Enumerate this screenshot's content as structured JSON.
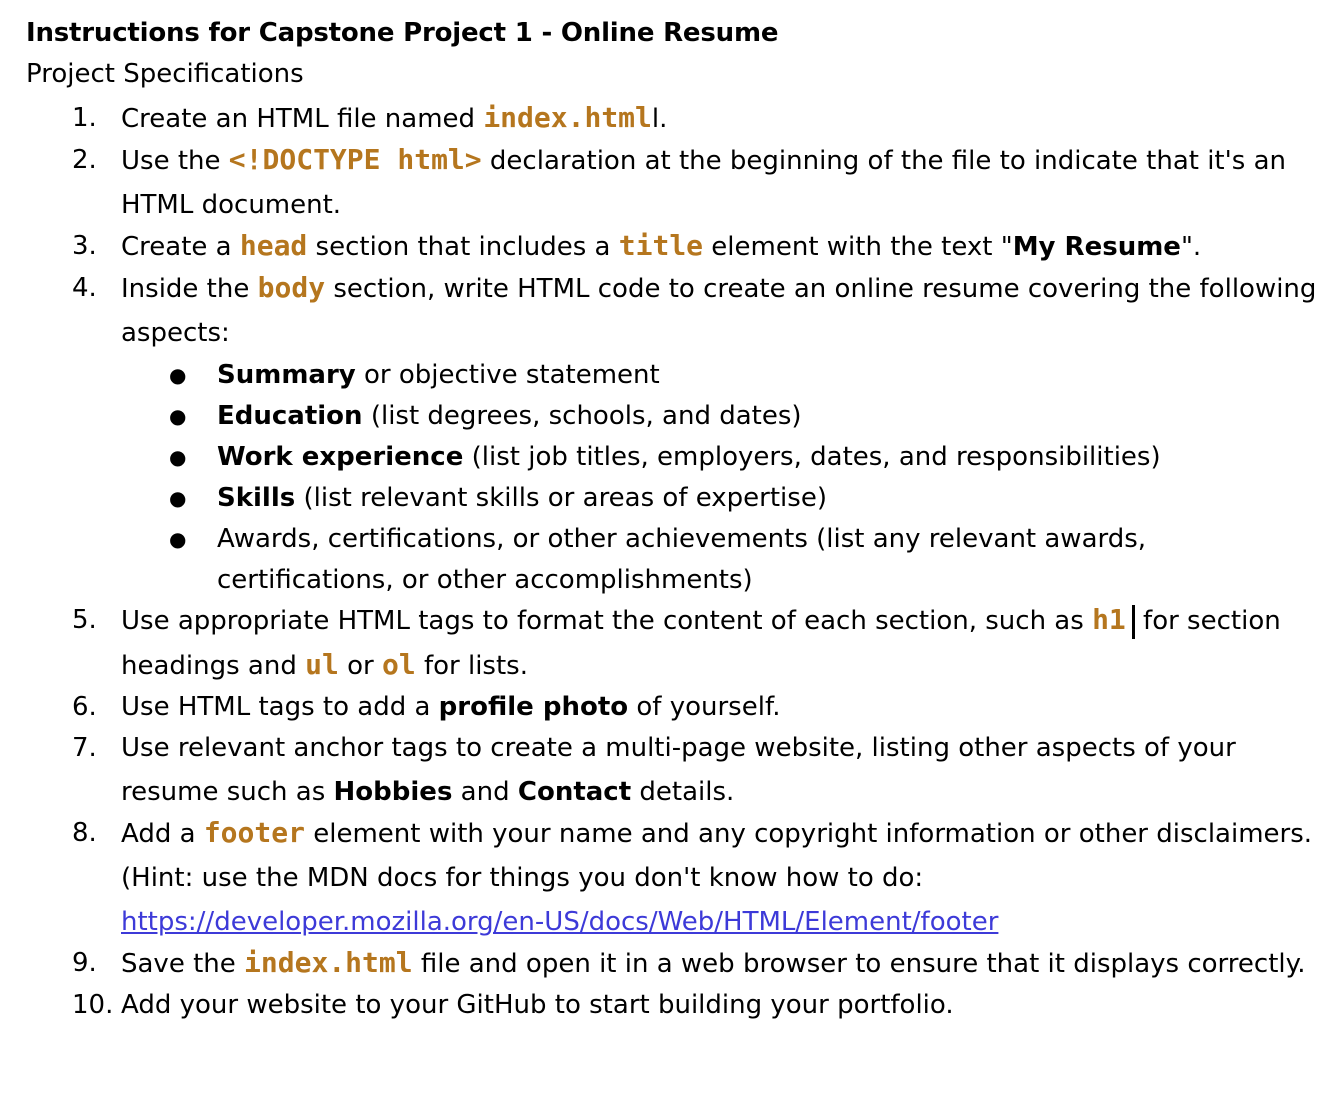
{
  "document": {
    "title": "Instructions for Capstone Project 1 - Online Resume",
    "subtitle": "Project Specifications",
    "colors": {
      "code_text": "#b5761e",
      "link": "#3d3ad8",
      "body_text": "#000000"
    },
    "steps": [
      {
        "number": "1.",
        "t1": "Create an HTML file named ",
        "code1": "index.html",
        "t2": "l."
      },
      {
        "number": "2.",
        "t1": "Use the ",
        "code1": "<!DOCTYPE html>",
        "t2": " declaration at the beginning of the file to indicate that it's an HTML document."
      },
      {
        "number": "3.",
        "t1": "Create a ",
        "code1": "head",
        "t2": " section that includes a ",
        "code2": "title",
        "t3": " element with the text \"",
        "bold1": "My Resume",
        "t4": "\"."
      },
      {
        "number": "4.",
        "t1": "Inside the ",
        "code1": "body",
        "t2": " section, write HTML code to create an online resume covering the following aspects:",
        "aspects": [
          {
            "bullet": "●",
            "bold": "Summary",
            "text": " or objective statement"
          },
          {
            "bullet": "●",
            "bold": "Education",
            "text": " (list degrees, schools, and dates)"
          },
          {
            "bullet": "●",
            "bold": "Work experience",
            "text": " (list job titles, employers, dates, and responsibilities)"
          },
          {
            "bullet": "●",
            "bold": "Skills",
            "text": " (list relevant skills or areas of expertise)"
          },
          {
            "bullet": "●",
            "bold": "",
            "text": "Awards, certifications, or other achievements (list any relevant awards, certifications, or other accomplishments)"
          }
        ]
      },
      {
        "number": "5.",
        "t1": "Use appropriate HTML tags to format the content of each section, such as ",
        "code1": "h1",
        "t2": " for section headings and ",
        "code2": "ul",
        "t3": " or ",
        "code3": "ol",
        "t4": " for lists."
      },
      {
        "number": "6.",
        "t1": "Use HTML tags to add a ",
        "bold1": "profile photo",
        "t2": " of yourself."
      },
      {
        "number": "7.",
        "t1": "Use relevant anchor tags to create a multi-page website, listing other aspects of your resume such as ",
        "bold1": "Hobbies",
        "t2": " and ",
        "bold2": "Contact",
        "t3": " details."
      },
      {
        "number": "8.",
        "t1": "Add a ",
        "code1": "footer",
        "t2": " element with your name and any copyright information or other disclaimers. (Hint: use the MDN docs for things you don't know how to do: ",
        "link": "https://developer.mozilla.org/en-US/docs/Web/HTML/Element/footer"
      },
      {
        "number": "9.",
        "t1": "Save the ",
        "code1": "index.html",
        "t2": " file and open it in a web browser to ensure that it displays correctly."
      },
      {
        "number": "10.",
        "t1": "Add your website to your GitHub to start building your portfolio."
      }
    ]
  }
}
